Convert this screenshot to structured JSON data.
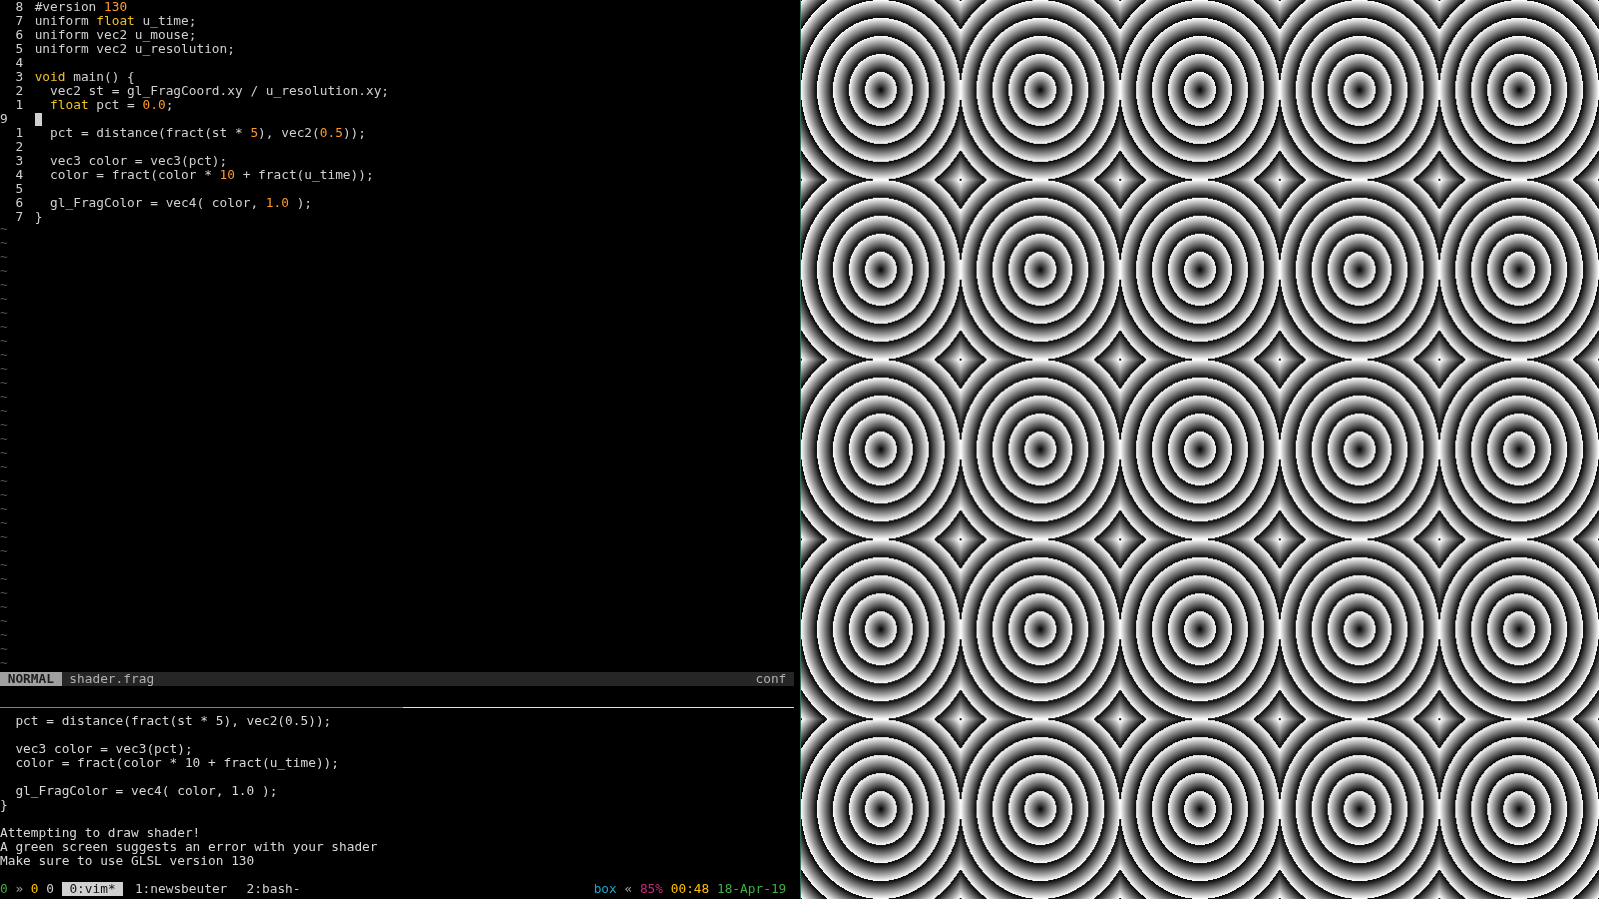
{
  "editor": {
    "lines": [
      {
        "number": "8",
        "current": false,
        "indented": false,
        "tokens": [
          {
            "text": "#version ",
            "kind": "plain"
          },
          {
            "text": "130",
            "kind": "number"
          }
        ]
      },
      {
        "number": "7",
        "current": false,
        "indented": false,
        "tokens": [
          {
            "text": "uniform ",
            "kind": "plain"
          },
          {
            "text": "float",
            "kind": "keyword"
          },
          {
            "text": " u_time;",
            "kind": "plain"
          }
        ]
      },
      {
        "number": "6",
        "current": false,
        "indented": false,
        "tokens": [
          {
            "text": "uniform vec2 u_mouse;",
            "kind": "plain"
          }
        ]
      },
      {
        "number": "5",
        "current": false,
        "indented": false,
        "tokens": [
          {
            "text": "uniform vec2 u_resolution;",
            "kind": "plain"
          }
        ]
      },
      {
        "number": "4",
        "current": false
      },
      {
        "number": "3",
        "current": false,
        "indented": false,
        "tokens": [
          {
            "text": "void",
            "kind": "keyword"
          },
          {
            "text": " main() {",
            "kind": "plain"
          }
        ]
      },
      {
        "number": "2",
        "current": false,
        "indented": true,
        "tokens": [
          {
            "text": "vec2 st = gl_FragCoord.xy / u_resolution.xy;",
            "kind": "plain"
          }
        ]
      },
      {
        "number": "1",
        "current": false,
        "indented": true,
        "tokens": [
          {
            "text": "float",
            "kind": "keyword"
          },
          {
            "text": " pct = ",
            "kind": "plain"
          },
          {
            "text": "0.0",
            "kind": "number"
          },
          {
            "text": ";",
            "kind": "plain"
          }
        ]
      },
      {
        "number": "9",
        "current": true
      },
      {
        "number": "1",
        "current": false,
        "indented": true,
        "tokens": [
          {
            "text": "pct = distance(fract(st * ",
            "kind": "plain"
          },
          {
            "text": "5",
            "kind": "number"
          },
          {
            "text": "), vec2(",
            "kind": "plain"
          },
          {
            "text": "0.5",
            "kind": "number"
          },
          {
            "text": "));",
            "kind": "plain"
          }
        ]
      },
      {
        "number": "2",
        "current": false
      },
      {
        "number": "3",
        "current": false,
        "indented": true,
        "tokens": [
          {
            "text": "vec3 color = vec3(pct);",
            "kind": "plain"
          }
        ]
      },
      {
        "number": "4",
        "current": false,
        "indented": true,
        "tokens": [
          {
            "text": "color = fract(color * ",
            "kind": "plain"
          },
          {
            "text": "10",
            "kind": "number"
          },
          {
            "text": " + fract(u_time));",
            "kind": "plain"
          }
        ]
      },
      {
        "number": "5",
        "current": false
      },
      {
        "number": "6",
        "current": false,
        "indented": true,
        "tokens": [
          {
            "text": "gl_FragColor = vec4( color, ",
            "kind": "plain"
          },
          {
            "text": "1.0",
            "kind": "number"
          },
          {
            "text": " );",
            "kind": "plain"
          }
        ]
      },
      {
        "number": "7",
        "current": false,
        "indented": false,
        "tokens": [
          {
            "text": "}",
            "kind": "plain"
          }
        ]
      }
    ],
    "empty_line_markers": [
      "~",
      "~",
      "~",
      "~",
      "~",
      "~",
      "~",
      "~",
      "~",
      "~",
      "~",
      "~",
      "~",
      "~",
      "~",
      "~",
      "~",
      "~",
      "~",
      "~",
      "~",
      "~",
      "~",
      "~",
      "~",
      "~",
      "~",
      "~",
      "~",
      "~",
      "~",
      "~"
    ],
    "status_line": {
      "mode": "NORMAL",
      "file": "shader.frag",
      "filetype": "conf"
    }
  },
  "console": {
    "blocks": [
      {
        "lines": [
          "  pct = distance(fract(st * 5), vec2(0.5));"
        ]
      },
      {
        "lines": [
          "  vec3 color = vec3(pct);",
          "  color = fract(color * 10 + fract(u_time));"
        ]
      },
      {
        "lines": [
          "  gl_FragColor = vec4( color, 1.0 );",
          "}"
        ]
      },
      {
        "lines": [
          "Attempting to draw shader!",
          "A green screen suggests an error with your shader",
          "Make sure to use GLSL version 130"
        ]
      }
    ]
  },
  "tmux_bar": {
    "session": {
      "text": "0",
      "color": "#3cb043"
    },
    "left_separator": "»",
    "left": [
      {
        "text": "0",
        "color": "#ffc000"
      },
      {
        "text": "0",
        "color": "#d0d0d0"
      }
    ],
    "windows": [
      {
        "label": "0:vim*",
        "selected": true
      },
      {
        "label": "1:newsbeuter",
        "selected": false
      },
      {
        "label": "2:bash-",
        "selected": false
      }
    ],
    "host": {
      "text": "box",
      "color": "#1fa3c8"
    },
    "right_separator": "«",
    "right": [
      {
        "text": "85%",
        "color": "#c8287a"
      },
      {
        "text": "00:48",
        "color": "#ffc000"
      },
      {
        "text": "18-Apr-19",
        "color": "#3cb043"
      }
    ]
  }
}
